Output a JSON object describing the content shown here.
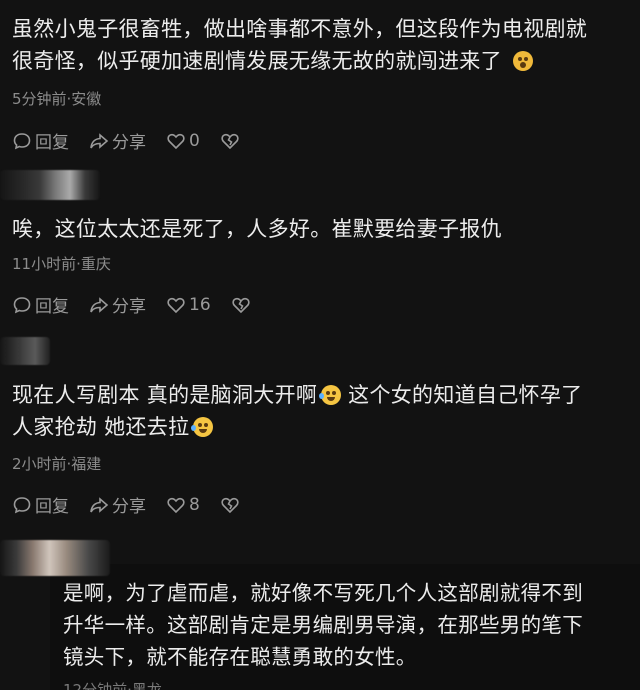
{
  "comments": [
    {
      "text_line1": "虽然小鬼子很畜牲，做出啥事都不意外，但这段作为电视剧就",
      "text_line2": "很奇怪，似乎硬加速剧情发展无缘无故的就闯进来了",
      "meta": "5分钟前·安徽",
      "reply_label": "回复",
      "share_label": "分享",
      "likes": "0"
    },
    {
      "text_line1": "唉，这位太太还是死了，人多好。崔默要给妻子报仇",
      "meta": "11小时前·重庆",
      "reply_label": "回复",
      "share_label": "分享",
      "likes": "16"
    },
    {
      "text_line1_a": "现在人写剧本 真的是脑洞大开啊",
      "text_line1_b": " 这个女的知道自己怀孕了",
      "text_line2": "人家抢劫 她还去拉",
      "meta": "2小时前·福建",
      "reply_label": "回复",
      "share_label": "分享",
      "likes": "8"
    },
    {
      "text_line1": "是啊，为了虐而虐，就好像不写死几个人这部剧就得不到",
      "text_line2": "升华一样。这部剧肯定是男编剧男导演，在那些男的笔下",
      "text_line3": "镜头下，就不能存在聪慧勇敢的女性。",
      "meta_partial": "12分钟前·黑龙"
    }
  ],
  "colors": {
    "background": "#121212",
    "text": "#ececec",
    "meta": "#8c8c8c",
    "icon": "#9a9a9a",
    "emoji": "#f5c542"
  },
  "icons": [
    "reply-icon",
    "share-icon",
    "like-heart-icon",
    "dislike-heart-icon",
    "laughing-emoji-icon",
    "shocked-emoji-icon"
  ]
}
